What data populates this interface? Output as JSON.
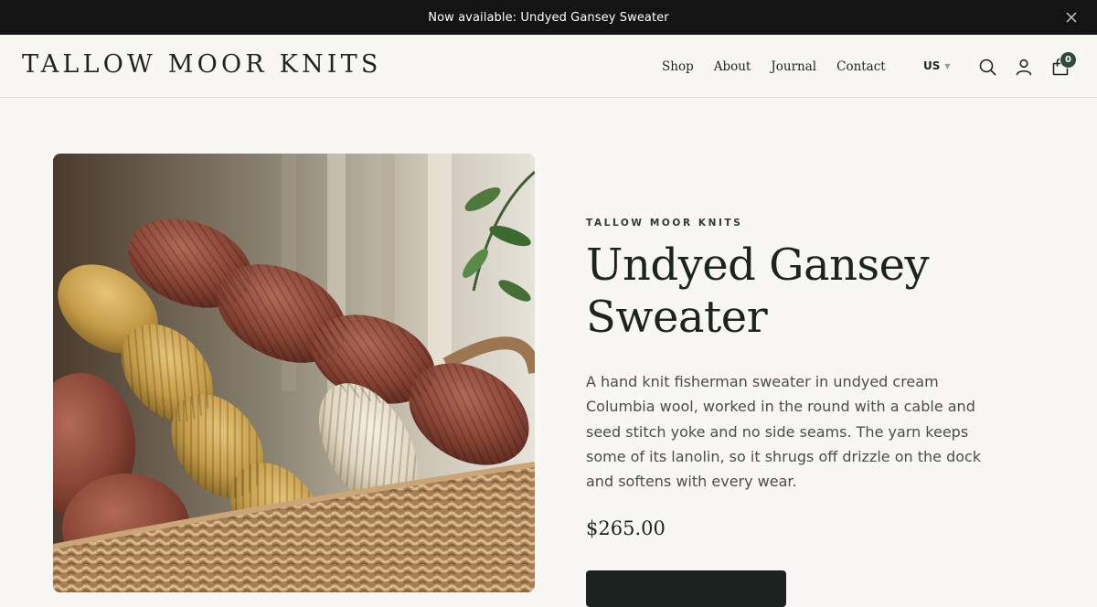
{
  "announcement": {
    "text": "Now available: Undyed Gansey Sweater",
    "close_icon": "close-icon"
  },
  "header": {
    "logo": "TALLOW MOOR KNITS",
    "nav": [
      "Shop",
      "About",
      "Journal",
      "Contact"
    ],
    "currency": "US",
    "icons": [
      "search-icon",
      "account-icon",
      "cart-icon"
    ],
    "cart_count": "0"
  },
  "product": {
    "vendor": "TALLOW MOOR KNITS",
    "title": "Undyed Gansey Sweater",
    "description": "A hand knit fisherman sweater in undyed cream Columbia wool, worked in the round with a cable and seed stitch yoke and no side seams. The yarn keeps some of its lanolin, so it shrugs off drizzle on the dock and softens with every wear.",
    "price": "$265.00",
    "image": "basket of yarn skeins"
  },
  "colors": {
    "announcement_bg": "#141414",
    "page_bg": "#f9f7f3",
    "accent": "#2e4a3d",
    "button_bg": "#1c221f"
  }
}
